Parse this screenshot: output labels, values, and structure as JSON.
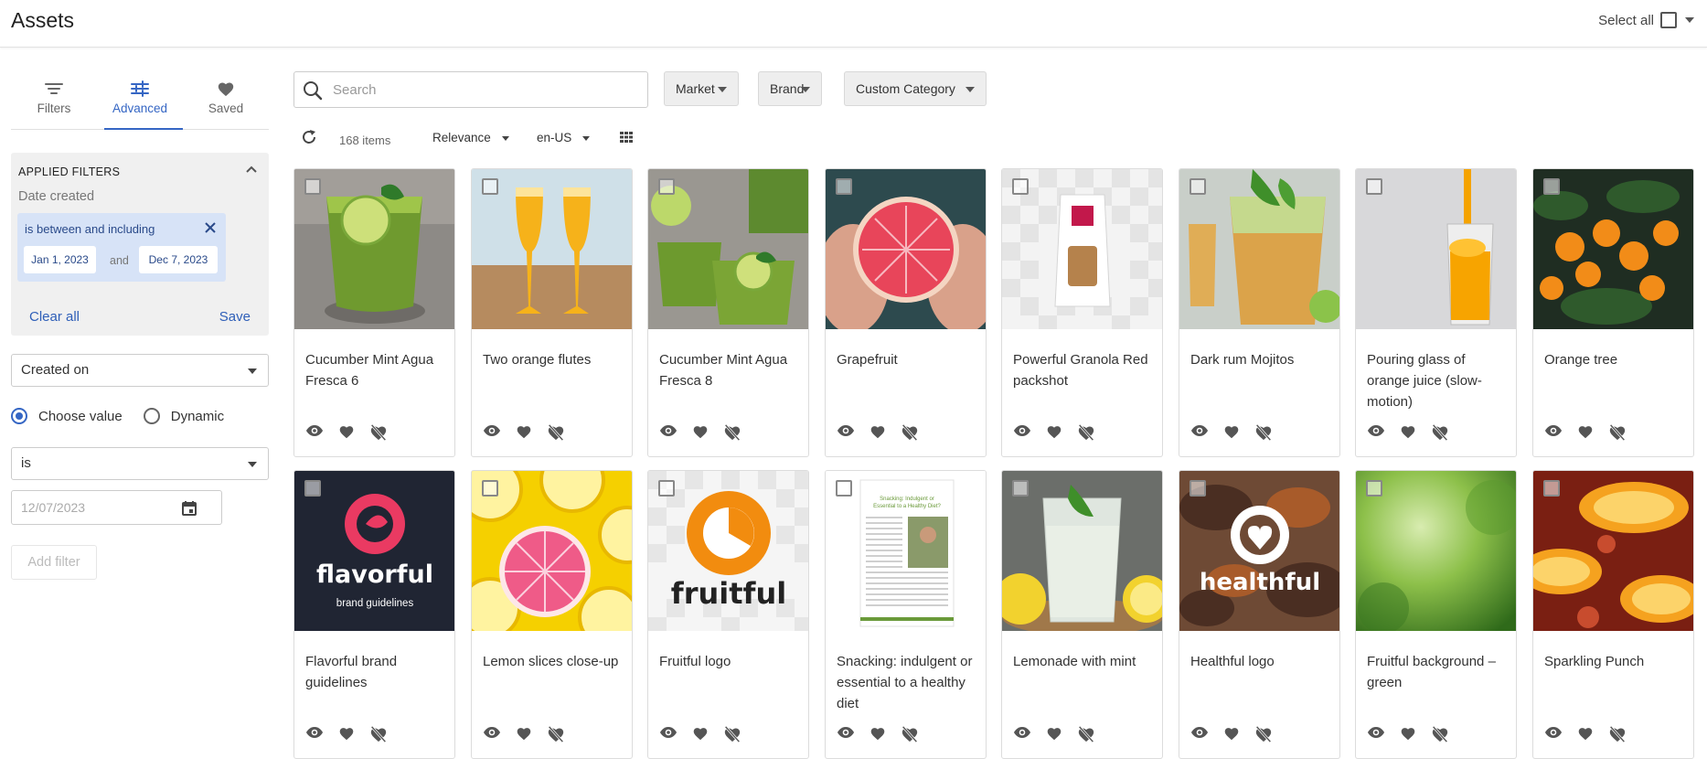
{
  "header": {
    "title": "Assets",
    "select_all_label": "Select all"
  },
  "sidebar": {
    "tabs": [
      {
        "label": "Filters",
        "icon": "filter-lines-icon"
      },
      {
        "label": "Advanced",
        "icon": "sliders-icon"
      },
      {
        "label": "Saved",
        "icon": "heart-icon"
      }
    ],
    "applied_filters": {
      "heading": "APPLIED FILTERS",
      "field_label": "Date created",
      "chip_text": "is between and including",
      "date_from": "Jan 1, 2023",
      "and_label": "and",
      "date_to": "Dec 7, 2023",
      "clear_all": "Clear all",
      "save": "Save"
    },
    "field_select": "Created on",
    "radio_choose": "Choose value",
    "radio_dynamic": "Dynamic",
    "operator_select": "is",
    "date_placeholder": "12/07/2023",
    "add_filter": "Add filter"
  },
  "toolbar": {
    "search_placeholder": "Search",
    "market": "Market",
    "brand": "Brand",
    "custom_category": "Custom Category",
    "items_count": "168 items",
    "sort": "Relevance",
    "locale": "en-US"
  },
  "assets": [
    {
      "title": "Cucumber Mint Agua Fresca 6",
      "thumb": "green-drink-photo"
    },
    {
      "title": "Two orange flutes",
      "thumb": "orange-flutes-photo"
    },
    {
      "title": "Cucumber Mint Agua Fresca 8",
      "thumb": "green-drinks-photo"
    },
    {
      "title": "Grapefruit",
      "thumb": "grapefruit-photo"
    },
    {
      "title": "Powerful Granola Red packshot",
      "thumb": "granola-packshot"
    },
    {
      "title": "Dark rum Mojitos",
      "thumb": "mojito-photo"
    },
    {
      "title": "Pouring glass of orange juice (slow-motion)",
      "thumb": "orange-juice-photo"
    },
    {
      "title": "Orange tree",
      "thumb": "orange-tree-photo"
    },
    {
      "title": "Flavorful brand guidelines",
      "thumb": "flavorful-logo",
      "logo_text": "flavorful",
      "logo_sub": "brand guidelines"
    },
    {
      "title": "Lemon slices close-up",
      "thumb": "lemon-slices-photo"
    },
    {
      "title": "Fruitful logo",
      "thumb": "fruitful-logo",
      "logo_text": "fruitful"
    },
    {
      "title": "Snacking: indulgent or essential to a healthy diet",
      "thumb": "document-preview"
    },
    {
      "title": "Lemonade with mint",
      "thumb": "lemonade-photo"
    },
    {
      "title": "Healthful logo",
      "thumb": "healthful-logo",
      "logo_text": "healthful"
    },
    {
      "title": "Fruitful background – green",
      "thumb": "green-bokeh-photo"
    },
    {
      "title": "Sparkling Punch",
      "thumb": "sparkling-punch-photo"
    }
  ],
  "colors": {
    "accent": "#3566c4",
    "chip_bg": "#d7e3f7",
    "flavorful_pink": "#ea3a62",
    "fruitful_orange": "#f28c0f"
  }
}
